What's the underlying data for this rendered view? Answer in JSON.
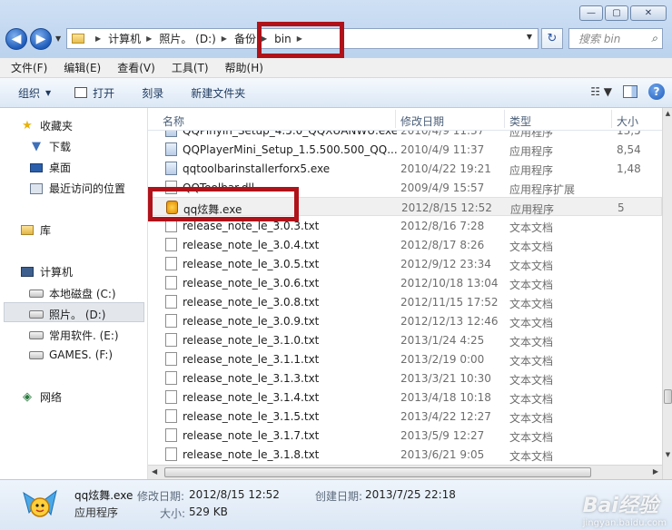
{
  "window": {
    "caption_buttons": [
      "—",
      "▢",
      "✕"
    ]
  },
  "address": {
    "crumbs": [
      "计算机",
      "照片。 (D:)",
      "备份",
      "bin"
    ],
    "search_placeholder": "搜索 bin"
  },
  "menu": [
    "文件(F)",
    "编辑(E)",
    "查看(V)",
    "工具(T)",
    "帮助(H)"
  ],
  "toolbar": {
    "organize": "组织",
    "open": "打开",
    "burn": "刻录",
    "new_folder": "新建文件夹"
  },
  "nav": {
    "favorites": "收藏夹",
    "downloads": "下载",
    "desktop": "桌面",
    "recent": "最近访问的位置",
    "libraries": "库",
    "computer": "计算机",
    "drive_c": "本地磁盘 (C:)",
    "drive_d": "照片。 (D:)",
    "drive_e": "常用软件. (E:)",
    "drive_f": "GAMES. (F:)",
    "network": "网络"
  },
  "columns": {
    "name": "名称",
    "date": "修改日期",
    "type": "类型",
    "size": "大小"
  },
  "files": [
    {
      "name": "QQPinyin_Setup_4.5.0_QQXUANWU.exe",
      "date": "2010/4/9 11:37",
      "type": "应用程序",
      "size": "13,5",
      "icon": "exe"
    },
    {
      "name": "QQPlayerMini_Setup_1.5.500.500_QQ...",
      "date": "2010/4/9 11:37",
      "type": "应用程序",
      "size": "8,54",
      "icon": "exe"
    },
    {
      "name": "qqtoolbarinstallerforx5.exe",
      "date": "2010/4/22 19:21",
      "type": "应用程序",
      "size": "1,48",
      "icon": "exe"
    },
    {
      "name": "QQToolbar.dll",
      "date": "2009/4/9 15:57",
      "type": "应用程序扩展",
      "size": "",
      "icon": "dll"
    },
    {
      "name": "qq炫舞.exe",
      "date": "2012/8/15 12:52",
      "type": "应用程序",
      "size": "5",
      "icon": "qq"
    },
    {
      "name": "release_note_le_3.0.3.txt",
      "date": "2012/8/16 7:28",
      "type": "文本文档",
      "size": "",
      "icon": "txt"
    },
    {
      "name": "release_note_le_3.0.4.txt",
      "date": "2012/8/17 8:26",
      "type": "文本文档",
      "size": "",
      "icon": "txt"
    },
    {
      "name": "release_note_le_3.0.5.txt",
      "date": "2012/9/12 23:34",
      "type": "文本文档",
      "size": "",
      "icon": "txt"
    },
    {
      "name": "release_note_le_3.0.6.txt",
      "date": "2012/10/18 13:04",
      "type": "文本文档",
      "size": "",
      "icon": "txt"
    },
    {
      "name": "release_note_le_3.0.8.txt",
      "date": "2012/11/15 17:52",
      "type": "文本文档",
      "size": "",
      "icon": "txt"
    },
    {
      "name": "release_note_le_3.0.9.txt",
      "date": "2012/12/13 12:46",
      "type": "文本文档",
      "size": "",
      "icon": "txt"
    },
    {
      "name": "release_note_le_3.1.0.txt",
      "date": "2013/1/24 4:25",
      "type": "文本文档",
      "size": "",
      "icon": "txt"
    },
    {
      "name": "release_note_le_3.1.1.txt",
      "date": "2013/2/19 0:00",
      "type": "文本文档",
      "size": "",
      "icon": "txt"
    },
    {
      "name": "release_note_le_3.1.3.txt",
      "date": "2013/3/21 10:30",
      "type": "文本文档",
      "size": "",
      "icon": "txt"
    },
    {
      "name": "release_note_le_3.1.4.txt",
      "date": "2013/4/18 10:18",
      "type": "文本文档",
      "size": "",
      "icon": "txt"
    },
    {
      "name": "release_note_le_3.1.5.txt",
      "date": "2013/4/22 12:27",
      "type": "文本文档",
      "size": "",
      "icon": "txt"
    },
    {
      "name": "release_note_le_3.1.7.txt",
      "date": "2013/5/9 12:27",
      "type": "文本文档",
      "size": "",
      "icon": "txt"
    },
    {
      "name": "release_note_le_3.1.8.txt",
      "date": "2013/6/21 9:05",
      "type": "文本文档",
      "size": "",
      "icon": "txt"
    }
  ],
  "selected_index": 4,
  "details": {
    "name": "qq炫舞.exe",
    "type": "应用程序",
    "modified_label": "修改日期:",
    "modified": "2012/8/15 12:52",
    "created_label": "创建日期:",
    "created": "2013/7/25 22:18",
    "size_label": "大小:",
    "size": "529 KB"
  },
  "watermark": {
    "brand": "Bai经验",
    "url": "jingyan.baidu.com"
  },
  "colors": {
    "highlight_box": "#b0121a"
  }
}
